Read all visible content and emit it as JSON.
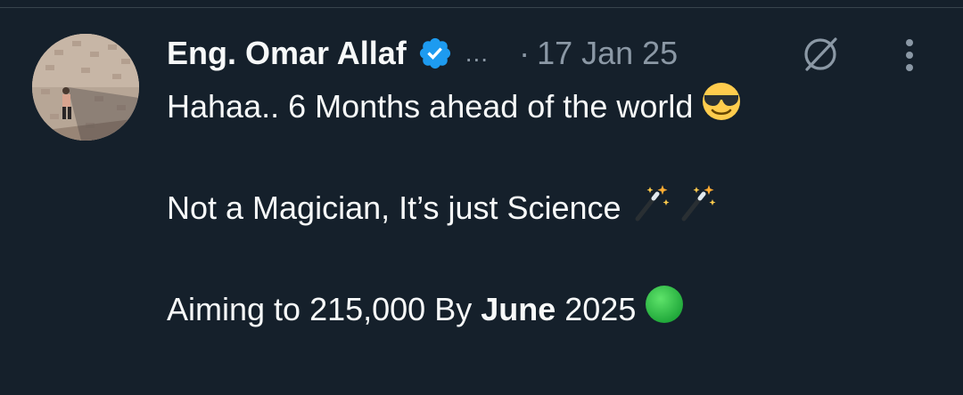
{
  "tweet": {
    "author": {
      "display_name": "Eng. Omar Allaf",
      "verified": true,
      "handle_truncated": "..."
    },
    "separator": "·",
    "date": "17 Jan 25",
    "body": {
      "line1": "Hahaa.. 6 Months ahead of the world",
      "line1_emoji": "smiling-face-with-sunglasses",
      "line2": "Not a Magician, It’s just Science",
      "line2_emoji": "magic-wand",
      "line3_prefix": "Aiming to 215,000 By ",
      "line3_bold": "June",
      "line3_suffix": " 2025",
      "line3_emoji": "green-circle"
    }
  },
  "colors": {
    "background": "#15202b",
    "text": "#f7f9f9",
    "muted": "#8b98a5",
    "verified": "#1d9bf0",
    "divider": "#38444d"
  }
}
